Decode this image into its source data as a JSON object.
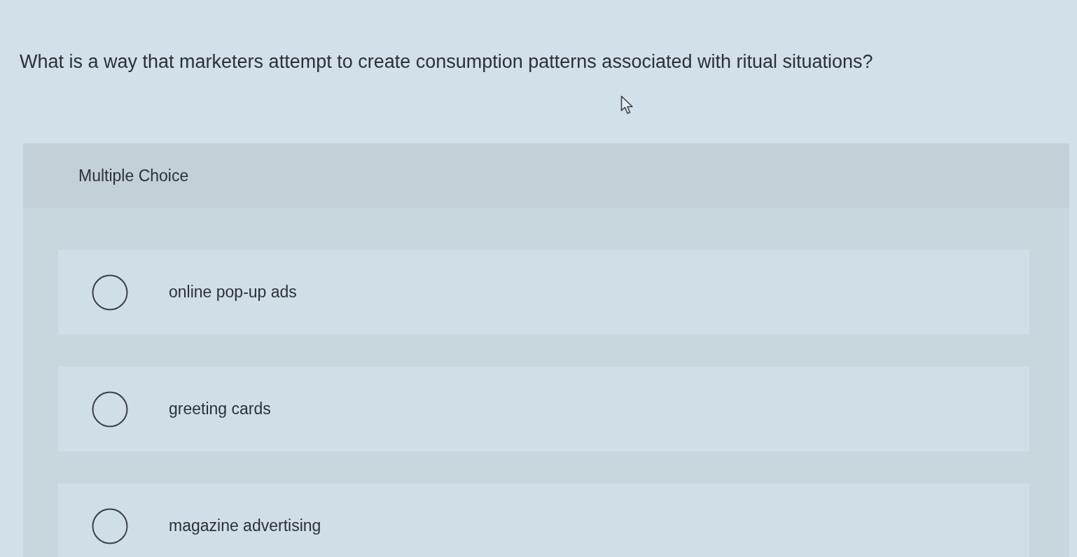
{
  "question": "What is a way that marketers attempt to create consumption patterns associated with ritual situations?",
  "multiple_choice": {
    "heading": "Multiple Choice",
    "options": [
      {
        "label": "online pop-up ads",
        "selected": false
      },
      {
        "label": "greeting cards",
        "selected": false
      },
      {
        "label": "magazine advertising",
        "selected": false
      }
    ]
  }
}
